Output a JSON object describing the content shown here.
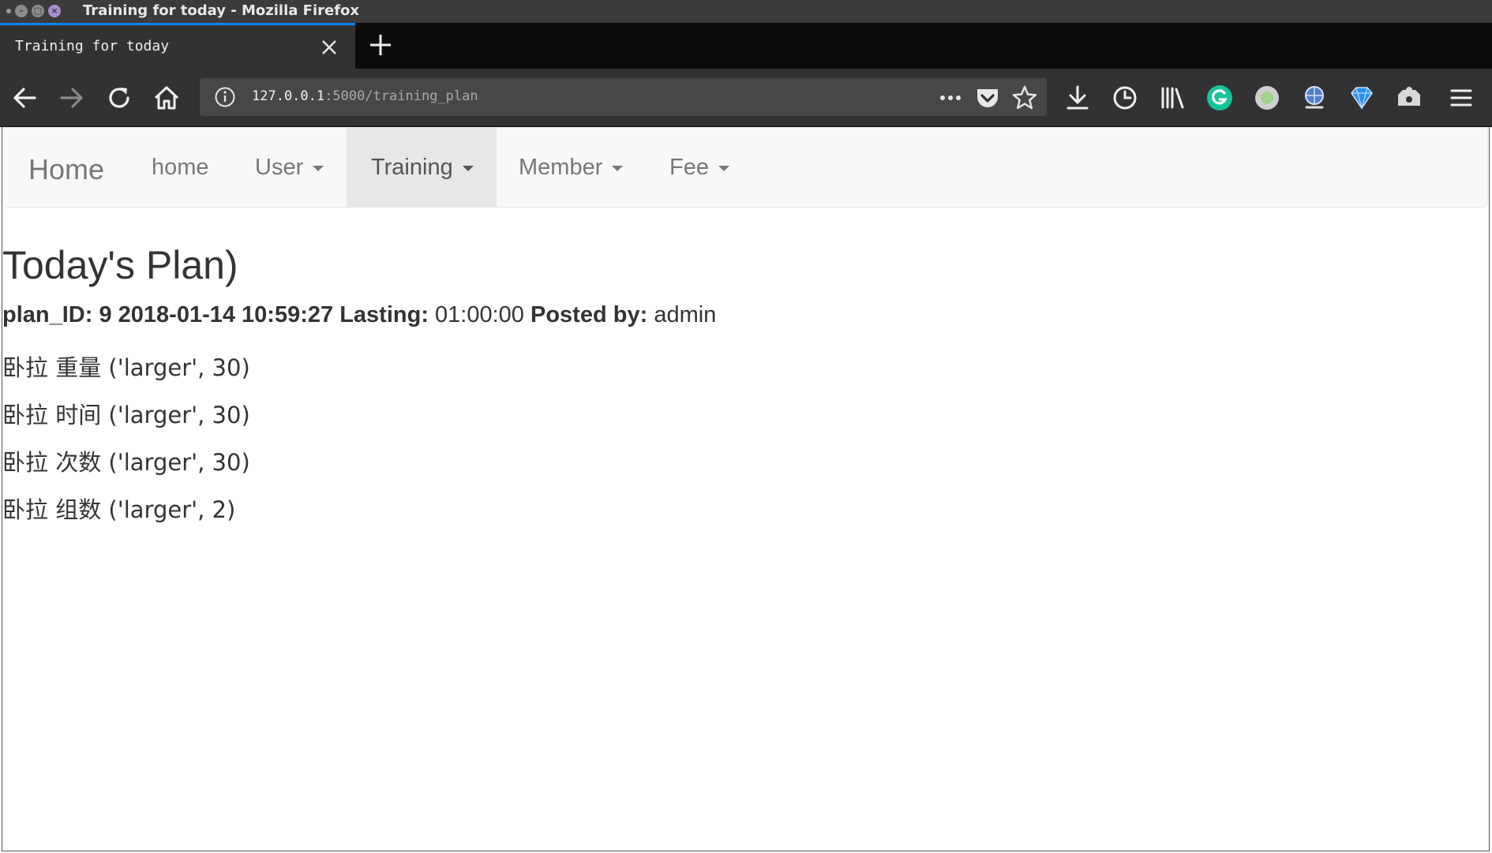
{
  "window": {
    "title": "Training for today - Mozilla Firefox"
  },
  "tabs": [
    {
      "title": "Training for today",
      "active": true
    }
  ],
  "urlbar": {
    "host": "127.0.0.1",
    "path": ":5000/training_plan"
  },
  "navbar": {
    "brand": "Home",
    "items": [
      {
        "label": "home",
        "dropdown": false,
        "active": false
      },
      {
        "label": "User",
        "dropdown": true,
        "active": false
      },
      {
        "label": "Training",
        "dropdown": true,
        "active": true
      },
      {
        "label": "Member",
        "dropdown": true,
        "active": false
      },
      {
        "label": "Fee",
        "dropdown": true,
        "active": false
      }
    ]
  },
  "content": {
    "heading": "Today's Plan)",
    "meta": {
      "plan_id_label": "plan_ID: 9 2018-01-14 10:59:27",
      "lasting_label": "Lasting:",
      "lasting_value": "01:00:00",
      "posted_label": "Posted by:",
      "posted_value": "admin"
    },
    "plan_items": [
      "卧拉 重量 ('larger', 30)",
      "卧拉 时间 ('larger', 30)",
      "卧拉 次数 ('larger', 30)",
      "卧拉 组数 ('larger', 2)"
    ]
  },
  "colors": {
    "tab_accent": "#0a84ff",
    "grammarly": "#15c39a",
    "active_nav_bg": "#e7e7e7"
  }
}
